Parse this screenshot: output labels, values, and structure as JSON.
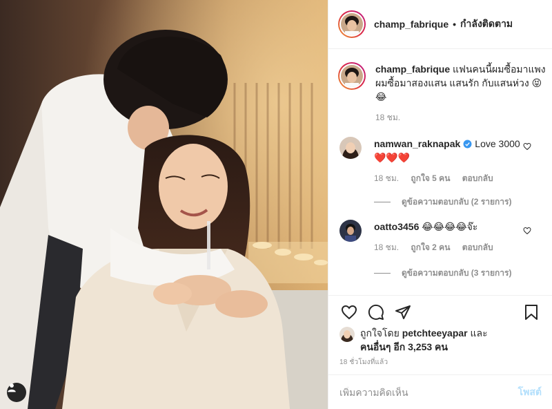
{
  "header": {
    "username": "champ_fabrique",
    "separator": "•",
    "follow_status": "กำลังติดตาม"
  },
  "caption": {
    "username": "champ_fabrique",
    "text": "แฟนคนนี้ผมซื้อมาแพง ผมซื้อมาสองแสน แสนรัก กับแสนห่วง 😝😂",
    "time": "18 ชม."
  },
  "comments": [
    {
      "username": "namwan_raknapak",
      "verified": true,
      "text": "Love 3000 ❤️❤️❤️",
      "time": "18 ชม.",
      "likes": "ถูกใจ 5 คน",
      "reply_label": "ตอบกลับ",
      "view_replies": "ดูข้อความตอบกลับ (2 รายการ)"
    },
    {
      "username": "oatto3456",
      "verified": false,
      "text": "😂😂😂😂จ๊ะ",
      "time": "18 ชม.",
      "likes": "ถูกใจ 2 คน",
      "reply_label": "ตอบกลับ",
      "view_replies": "ดูข้อความตอบกลับ (3 รายการ)"
    }
  ],
  "likes": {
    "prefix": "ถูกใจโดย",
    "user": "petchteeyapar",
    "conjunction": "และ",
    "others": "คนอื่นๆ",
    "count_text": "อีก 3,253 คน"
  },
  "time_ago": "18 ชั่วโมงที่แล้ว",
  "add_comment": {
    "placeholder": "เพิ่มความคิดเห็น",
    "post_label": "โพสต์"
  },
  "colors": {
    "verified": "#3897f0",
    "post_disabled": "#b2dffc",
    "muted": "#8e8e8e"
  },
  "icons": [
    "heart-icon",
    "comment-icon",
    "share-icon",
    "bookmark-icon",
    "user-tag-icon",
    "verified-badge-icon"
  ]
}
